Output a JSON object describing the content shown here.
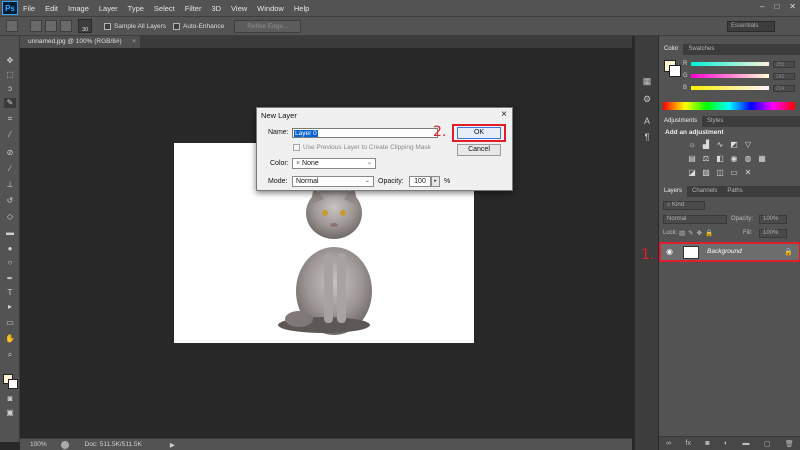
{
  "app": {
    "logo": "Ps"
  },
  "menu": [
    "File",
    "Edit",
    "Image",
    "Layer",
    "Type",
    "Select",
    "Filter",
    "3D",
    "View",
    "Window",
    "Help"
  ],
  "options_bar": {
    "brush_size": "30",
    "sample_all_layers": "Sample All Layers",
    "auto_enhance": "Auto-Enhance",
    "refine_edge": "Refine Edge...",
    "workspace": "Essentials"
  },
  "document": {
    "tab_title": "unnamed.jpg @ 100% (RGB/8#)",
    "zoom": "100%",
    "doc_info": "Doc: 511.5K/511.5K"
  },
  "panels": {
    "color_tabs": [
      "Color",
      "Swatches"
    ],
    "color_channels": [
      {
        "label": "R",
        "value": "255"
      },
      {
        "label": "G",
        "value": "242"
      },
      {
        "label": "B",
        "value": "214"
      }
    ],
    "adjustments_tabs": [
      "Adjustments",
      "Styles"
    ],
    "add_adjustment": "Add an adjustment",
    "layers_tabs": [
      "Layers",
      "Channels",
      "Paths"
    ],
    "kind_filter": "Kind",
    "blend_mode": "Normal",
    "opacity_label": "Opacity:",
    "opacity_value": "100%",
    "lock_label": "Lock:",
    "fill_label": "Fill:",
    "fill_value": "100%",
    "layer_name": "Background"
  },
  "dialog": {
    "title": "New Layer",
    "name_label": "Name:",
    "name_value": "Layer 0",
    "clip_label": "Use Previous Layer to Create Clipping Mask",
    "color_label": "Color:",
    "color_value": "None",
    "mode_label": "Mode:",
    "mode_value": "Normal",
    "opacity_label": "Opacity:",
    "opacity_value": "100",
    "percent": "%",
    "ok": "OK",
    "cancel": "Cancel"
  },
  "annotations": {
    "step1": "1.",
    "step2": "2."
  },
  "colors": {
    "annotation_red": "#e01e2e",
    "foreground": "#fdf1d6",
    "accent_blue": "#0a64d2"
  }
}
